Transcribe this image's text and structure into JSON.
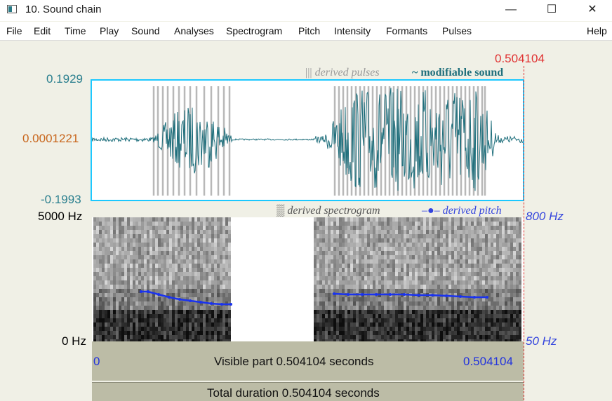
{
  "window": {
    "title": "10. Sound chain",
    "minimize_glyph": "—",
    "maximize_glyph": "☐",
    "close_glyph": "✕"
  },
  "menu": [
    "File",
    "Edit",
    "Time",
    "Play",
    "Sound",
    "Analyses",
    "Spectrogram",
    "Pitch",
    "Intensity",
    "Formants",
    "Pulses",
    "Help"
  ],
  "waveform": {
    "max_label": "0.1929",
    "mid_label": "0.0001221",
    "min_label": "-0.1993",
    "legend_pulses_glyph": "|||",
    "legend_pulses": "derived pulses",
    "legend_sound_glyph": "~",
    "legend_sound": "modifiable sound"
  },
  "spectrogram": {
    "top_label": "5000 Hz",
    "bottom_label": "0 Hz",
    "legend_spec_glyph": "▒",
    "legend_spec": "derived spectrogram",
    "legend_pitch_glyph": "–●–",
    "legend_pitch": "derived pitch",
    "pitch_top_label": "800 Hz",
    "pitch_bottom_label": "50 Hz"
  },
  "cursor": {
    "time": "0.504104"
  },
  "visible_bar": {
    "start": "0",
    "text": "Visible part 0.504104 seconds",
    "end": "0.504104"
  },
  "total_bar": {
    "text": "Total duration 0.504104 seconds"
  },
  "colors": {
    "wave": "#1f6f7c",
    "frame": "#1cc8ff",
    "cursor": "#e03030",
    "pitch": "#1a33ee",
    "axis_teal": "#2a7f8e",
    "axis_orange": "#c8661c",
    "axis_blue": "#3344dd"
  }
}
